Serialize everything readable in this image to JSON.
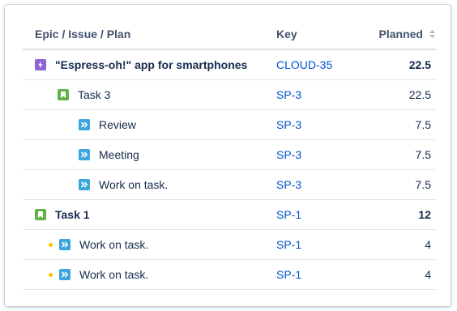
{
  "columns": {
    "name": "Epic / Issue / Plan",
    "key": "Key",
    "planned": "Planned"
  },
  "rows": [
    {
      "icon": "epic-icon",
      "name": "\"Espress-oh!\" app for smartphones",
      "key": "CLOUD-35",
      "planned": "22.5",
      "bold": true
    },
    {
      "icon": "story-icon",
      "name": "Task 3",
      "key": "SP-3",
      "planned": "22.5",
      "bold": false
    },
    {
      "icon": "subtask-icon",
      "name": "Review",
      "key": "SP-3",
      "planned": "7.5",
      "bold": false
    },
    {
      "icon": "subtask-icon",
      "name": "Meeting",
      "key": "SP-3",
      "planned": "7.5",
      "bold": false
    },
    {
      "icon": "subtask-icon",
      "name": "Work on task.",
      "key": "SP-3",
      "planned": "7.5",
      "bold": false
    },
    {
      "icon": "story-icon",
      "name": "Task 1",
      "key": "SP-1",
      "planned": "12",
      "bold": true
    },
    {
      "icon": "subtask-icon",
      "name": "Work on task.",
      "key": "SP-1",
      "planned": "4",
      "bold": false,
      "dot": true
    },
    {
      "icon": "subtask-icon",
      "name": "Work on task.",
      "key": "SP-1",
      "planned": "4",
      "bold": false,
      "dot": true
    }
  ],
  "colors": {
    "epic": "#8f64d8",
    "story": "#62b24a",
    "subtask": "#3aa6dc",
    "link": "#0052cc",
    "dot": "#ffc400"
  }
}
